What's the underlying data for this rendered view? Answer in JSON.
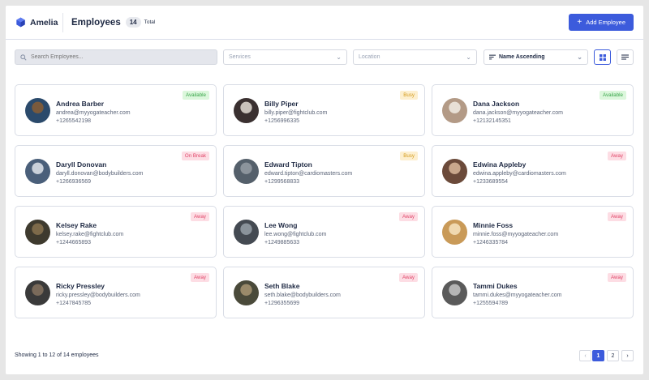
{
  "app": {
    "name": "Amelia"
  },
  "header": {
    "title": "Employees",
    "count": "14",
    "total_label": "Total",
    "add_button": "Add Employee"
  },
  "filters": {
    "search_placeholder": "Search Employees...",
    "services_placeholder": "Services",
    "location_placeholder": "Location",
    "sort_value": "Name Ascending"
  },
  "employees": [
    {
      "name": "Andrea Barber",
      "email": "andrea@myyogateacher.com",
      "phone": "+1265542198",
      "status": "Available",
      "status_type": "available"
    },
    {
      "name": "Billy Piper",
      "email": "billy.piper@fightclub.com",
      "phone": "+1256996335",
      "status": "Busy",
      "status_type": "busy"
    },
    {
      "name": "Dana Jackson",
      "email": "dana.jackson@myyogateacher.com",
      "phone": "+12132145351",
      "status": "Available",
      "status_type": "available"
    },
    {
      "name": "Daryll Donovan",
      "email": "daryll.donovan@bodybuilders.com",
      "phone": "+1266936569",
      "status": "On Break",
      "status_type": "onbreak"
    },
    {
      "name": "Edward Tipton",
      "email": "edward.tipton@cardiomasters.com",
      "phone": "+1299568833",
      "status": "Busy",
      "status_type": "busy"
    },
    {
      "name": "Edwina Appleby",
      "email": "edwina.appleby@cardiomasters.com",
      "phone": "+1233689554",
      "status": "Away",
      "status_type": "away"
    },
    {
      "name": "Kelsey Rake",
      "email": "kelsey.rake@fightclub.com",
      "phone": "+1244665893",
      "status": "Away",
      "status_type": "away"
    },
    {
      "name": "Lee Wong",
      "email": "lee.wong@fightclub.com",
      "phone": "+1249885633",
      "status": "Away",
      "status_type": "away"
    },
    {
      "name": "Minnie Foss",
      "email": "minnie.foss@myyogateacher.com",
      "phone": "+1246335784",
      "status": "Away",
      "status_type": "away"
    },
    {
      "name": "Ricky Pressley",
      "email": "ricky.pressley@bodybuilders.com",
      "phone": "+1247845785",
      "status": "Away",
      "status_type": "away"
    },
    {
      "name": "Seth Blake",
      "email": "seth.blake@bodybuilders.com",
      "phone": "+1296355699",
      "status": "Away",
      "status_type": "away"
    },
    {
      "name": "Tammi Dukes",
      "email": "tammi.dukes@myyogateacher.com",
      "phone": "+1255594789",
      "status": "Away",
      "status_type": "away"
    }
  ],
  "footer": {
    "showing_text": "Showing 1 to 12 of 14 employees"
  },
  "pagination": {
    "prev": "‹",
    "pages": [
      "1",
      "2"
    ],
    "next": "›",
    "current": "1"
  },
  "colors": {
    "accent": "#3c5bdc",
    "available": "#3aa64b",
    "busy": "#d49b1c",
    "away": "#e0486a"
  }
}
